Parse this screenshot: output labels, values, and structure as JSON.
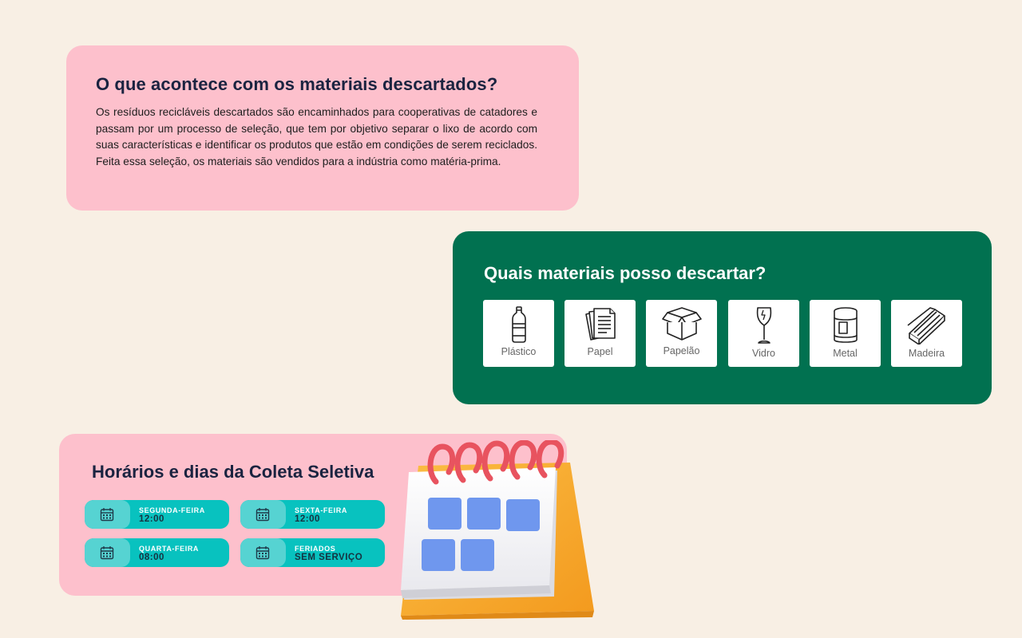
{
  "info": {
    "title": "O que acontece com os materiais descartados?",
    "body": "Os resíduos recicláveis descartados são encaminhados para cooperativas de catadores e passam por um processo de seleção, que tem por objetivo separar o lixo de acordo com suas características e identificar os produtos que estão em condições de serem reciclados. Feita essa seleção, os materiais são vendidos para a indústria como matéria-prima."
  },
  "materials": {
    "title": "Quais materiais posso descartar?",
    "items": [
      {
        "label": "Plástico",
        "icon": "plastic-bottle-icon"
      },
      {
        "label": "Papel",
        "icon": "paper-sheets-icon"
      },
      {
        "label": "Papelão",
        "icon": "cardboard-box-icon"
      },
      {
        "label": "Vidro",
        "icon": "wine-glass-icon"
      },
      {
        "label": "Metal",
        "icon": "metal-can-icon"
      },
      {
        "label": "Madeira",
        "icon": "wood-planks-icon"
      }
    ]
  },
  "schedule": {
    "title": "Horários e dias da Coleta Seletiva",
    "slots": [
      {
        "day": "SEGUNDA-FEIRA",
        "time": "12:00"
      },
      {
        "day": "SEXTA-FEIRA",
        "time": "12:00"
      },
      {
        "day": "QUARTA-FEIRA",
        "time": "08:00"
      },
      {
        "day": "FERIADOS",
        "time": "SEM SERVIÇO"
      }
    ]
  },
  "colors": {
    "background": "#f8efe4",
    "pink_card": "#fdc0cc",
    "green_card": "#017150",
    "teal_slot": "#08c2bf",
    "teal_slot_icon": "#56d3d2",
    "title_dark": "#1a2340"
  }
}
